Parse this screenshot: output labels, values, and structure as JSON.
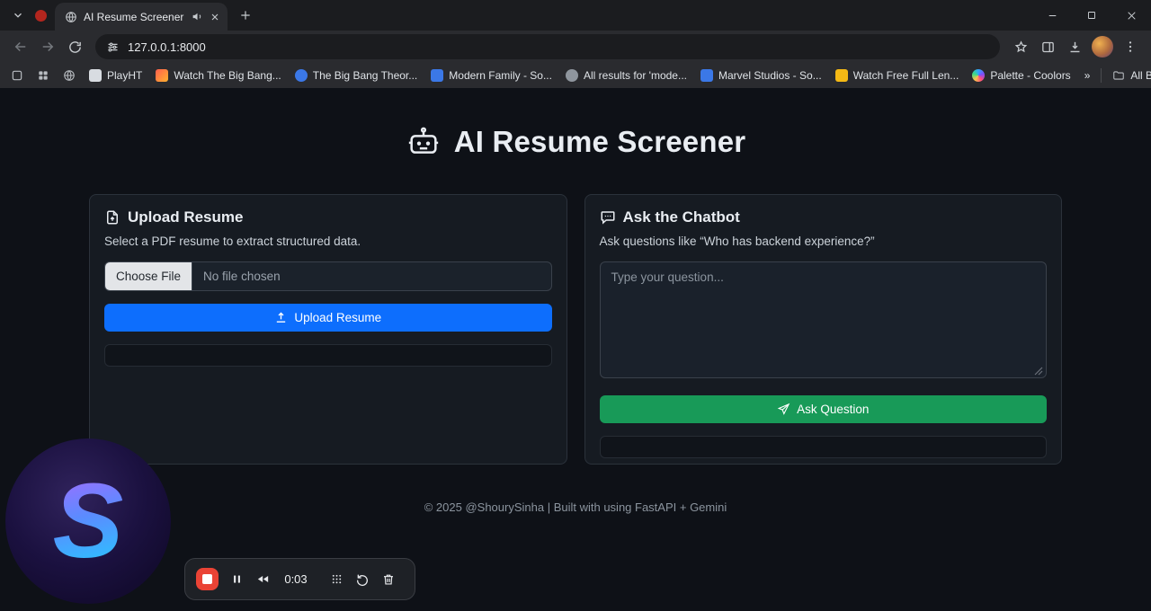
{
  "browser": {
    "tab_title": "AI Resume Screener",
    "url": "127.0.0.1:8000",
    "bookmarks": {
      "items": [
        {
          "label": "PlayHT",
          "favicon_style": "background:#d8dce1"
        },
        {
          "label": "Watch The Big Bang...",
          "favicon_style": "background:linear-gradient(135deg,#ff5f4e,#ffb12e)"
        },
        {
          "label": "The Big Bang Theor...",
          "favicon_style": "background:#3b78e7;border-radius:50%"
        },
        {
          "label": "Modern Family - So...",
          "favicon_style": "background:#3b78e7"
        },
        {
          "label": "All results for 'mode...",
          "favicon_style": "background:#8f969e;border-radius:50%"
        },
        {
          "label": "Marvel Studios - So...",
          "favicon_style": "background:#3b78e7"
        },
        {
          "label": "Watch Free Full Len...",
          "favicon_style": "background:#f5b915"
        },
        {
          "label": "Palette - Coolors",
          "favicon_style": "background:conic-gradient(#2ea7ff,#7d4cff,#ff4c7d,#ffc24c,#3ddc84,#2ea7ff);border-radius:50%"
        }
      ],
      "overflow": "»",
      "all_bookmarks": "All Bookmarks"
    }
  },
  "page": {
    "title": "AI Resume Screener",
    "upload_card": {
      "heading": "Upload Resume",
      "subtitle": "Select a PDF resume to extract structured data.",
      "file_button_label": "Choose File",
      "file_status": "No file chosen",
      "upload_button_label": "Upload Resume"
    },
    "chat_card": {
      "heading": "Ask the Chatbot",
      "subtitle": "Ask questions like “Who has backend experience?”",
      "textarea_placeholder": "Type your question...",
      "ask_button_label": "Ask Question"
    },
    "footer": "© 2025 @ShourySinha | Built with using FastAPI + Gemini"
  },
  "overlays": {
    "recorder": {
      "time": "0:03"
    },
    "webcam": {
      "letter": "S"
    }
  },
  "colors": {
    "primary_button": "#0d6efd",
    "success_button": "#189a58",
    "page_bg": "#0e1117",
    "card_bg": "#161b22",
    "record_red": "#ea4335"
  }
}
